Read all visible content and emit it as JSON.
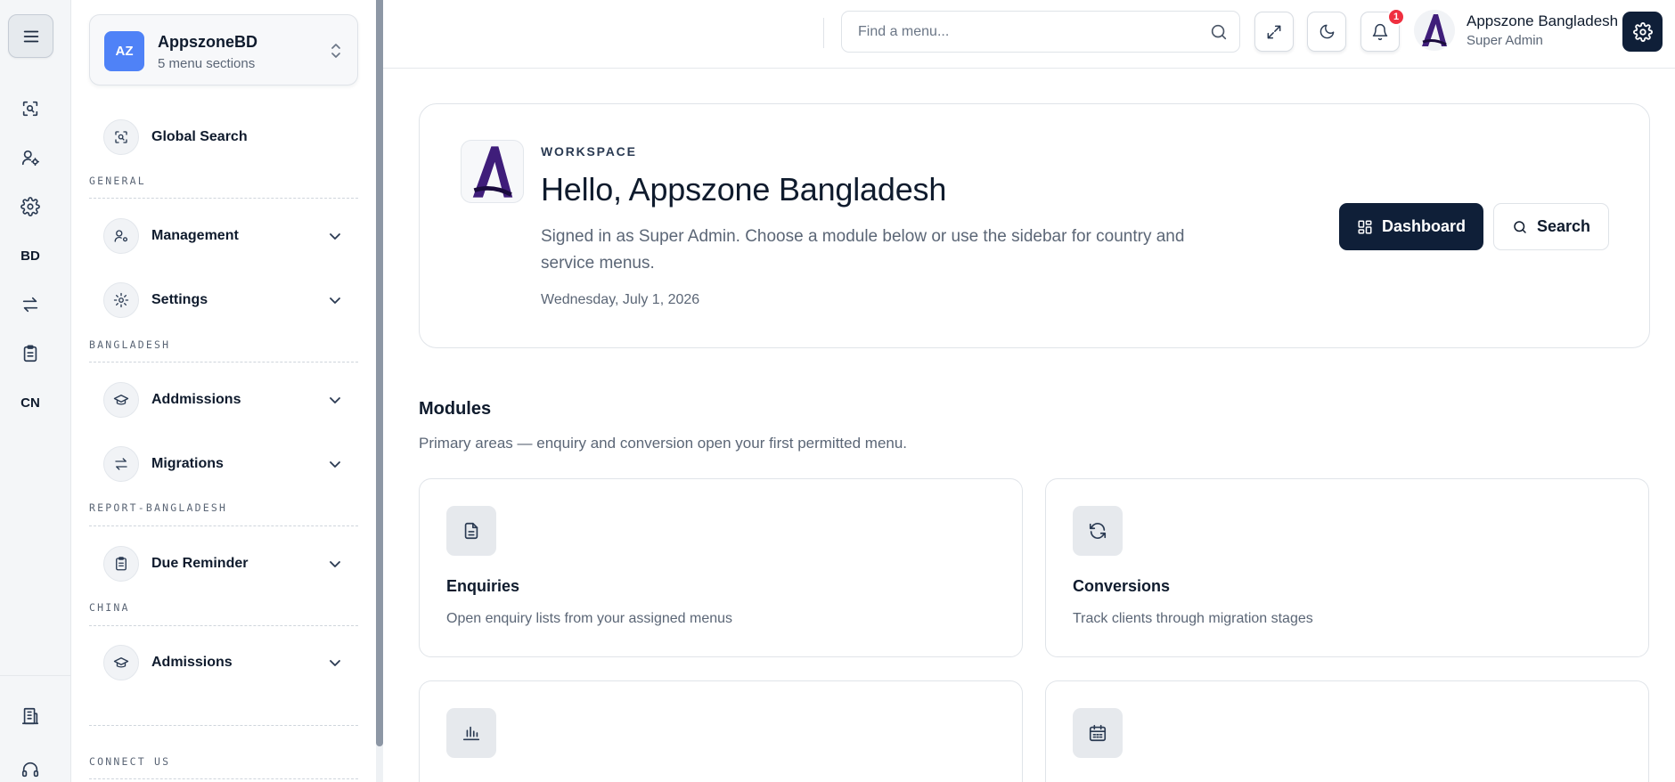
{
  "rail": {
    "items": [
      {
        "icon": "search-scan-icon"
      },
      {
        "icon": "user-gear-icon"
      },
      {
        "icon": "gear-icon"
      },
      {
        "text": "BD"
      },
      {
        "icon": "arrows-exchange-icon"
      },
      {
        "icon": "clipboard-icon"
      },
      {
        "text": "CN"
      },
      {
        "icon": "building-icon"
      },
      {
        "icon": "headset-icon"
      }
    ]
  },
  "workspace": {
    "avatar": "AZ",
    "name": "AppszoneBD",
    "subtitle": "5 menu sections"
  },
  "sidebar": {
    "global_search": "Global Search",
    "sections": {
      "general": "GENERAL",
      "bangladesh": "BANGLADESH",
      "report": "REPORT-BANGLADESH",
      "china": "CHINA",
      "connect": "CONNECT US"
    },
    "items": {
      "management": "Management",
      "settings": "Settings",
      "admissions_bd": "Addmissions",
      "migrations": "Migrations",
      "due_reminder": "Due Reminder",
      "admissions_cn": "Admissions"
    }
  },
  "header": {
    "search_placeholder": "Find a menu...",
    "notification_count": "1",
    "user_name": "Appszone Bangladesh",
    "user_role": "Super Admin"
  },
  "hero": {
    "eyebrow": "WORKSPACE",
    "title": "Hello, Appszone Bangladesh",
    "subtitle": "Signed in as Super Admin. Choose a module below or use the sidebar for country and service menus.",
    "date": "Wednesday, July 1, 2026",
    "primary_button": "Dashboard",
    "secondary_button": "Search"
  },
  "modules": {
    "title": "Modules",
    "subtitle": "Primary areas — enquiry and conversion open your first permitted menu.",
    "cards": [
      {
        "icon": "document-icon",
        "title": "Enquiries",
        "description": "Open enquiry lists from your assigned menus"
      },
      {
        "icon": "refresh-icon",
        "title": "Conversions",
        "description": "Track clients through migration stages"
      },
      {
        "icon": "bar-chart-icon"
      },
      {
        "icon": "calendar-icon"
      }
    ]
  },
  "colors": {
    "primary": "#0f1f38",
    "accent_avatar": "#4f82f7",
    "badge": "#ef2f3f",
    "logo_purple": "#3f1d7a"
  }
}
